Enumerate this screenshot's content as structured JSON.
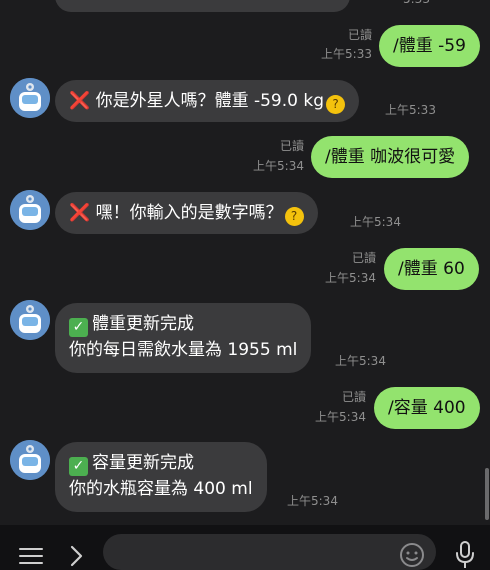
{
  "messages": [
    {
      "id": "m0",
      "dir": "in",
      "lines": [
        "…"
      ]
    },
    {
      "id": "m1",
      "dir": "out",
      "text": "/體重 -59",
      "read": "已讀",
      "time": "上午5:33"
    },
    {
      "id": "m2",
      "dir": "in",
      "emoji": "❌",
      "text": "你是外星人嗎？體重 -59.0 kg",
      "trail": "🤔",
      "time": "上午5:33"
    },
    {
      "id": "m3",
      "dir": "out",
      "text": "/體重 咖波很可愛",
      "read": "已讀",
      "time": "上午5:34"
    },
    {
      "id": "m4",
      "dir": "in",
      "emoji": "❌",
      "text": "嘿！你輸入的是數字嗎？",
      "trail": "🤔",
      "time": "上午5:34"
    },
    {
      "id": "m5",
      "dir": "out",
      "text": "/體重 60",
      "read": "已讀",
      "time": "上午5:34"
    },
    {
      "id": "m6",
      "dir": "in",
      "emoji": "✅",
      "lines": [
        "體重更新完成",
        "你的每日需飲水量為 1955 ml"
      ],
      "time": "上午5:34"
    },
    {
      "id": "m7",
      "dir": "out",
      "text": "/容量 400",
      "read": "已讀",
      "time": "上午5:34"
    },
    {
      "id": "m8",
      "dir": "in",
      "emoji": "✅",
      "lines": [
        "容量更新完成",
        "你的水瓶容量為 400 ml"
      ],
      "time": "上午5:34"
    }
  ],
  "toolbar": {
    "menu_icon": "hamburger-menu-icon",
    "expand_icon": "chevron-right-icon",
    "emoji_icon": "smiley-icon",
    "mic_icon": "microphone-icon",
    "message_placeholder": ""
  },
  "colors": {
    "background": "#1c1c1e",
    "outgoing_bubble": "#93e36e",
    "incoming_bubble": "#3b3b3d",
    "avatar": "#5f8fc7",
    "meta_text": "#8f8f8f"
  }
}
